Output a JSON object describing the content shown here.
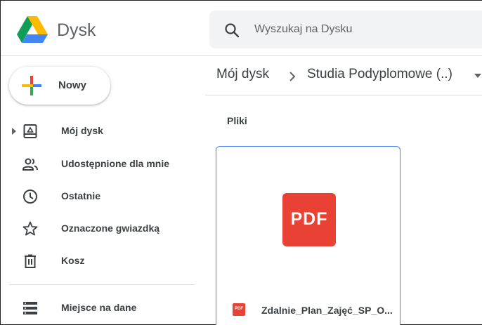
{
  "app": {
    "title": "Dysk"
  },
  "search": {
    "placeholder": "Wyszukaj na Dysku",
    "value": ""
  },
  "new_button": {
    "label": "Nowy"
  },
  "sidebar": {
    "items": [
      {
        "label": "Mój dysk",
        "icon": "my-drive-icon"
      },
      {
        "label": "Udostępnione dla mnie",
        "icon": "shared-people-icon"
      },
      {
        "label": "Ostatnie",
        "icon": "clock-icon"
      },
      {
        "label": "Oznaczone gwiazdką",
        "icon": "star-icon"
      },
      {
        "label": "Kosz",
        "icon": "trash-icon"
      },
      {
        "label": "Miejsce na dane",
        "icon": "storage-icon"
      }
    ]
  },
  "breadcrumb": {
    "root": "Mój dysk",
    "current": "Studia Podyplomowe (..)"
  },
  "main": {
    "section_title": "Pliki"
  },
  "files": [
    {
      "name": "Zdalnie_Plan_Zajęć_SP_O...",
      "type_label": "PDF"
    }
  ],
  "colors": {
    "accent": "#4285f4",
    "pdf_red": "#e94235",
    "text": "#3c4043",
    "search_bg": "#f1f3f4"
  }
}
